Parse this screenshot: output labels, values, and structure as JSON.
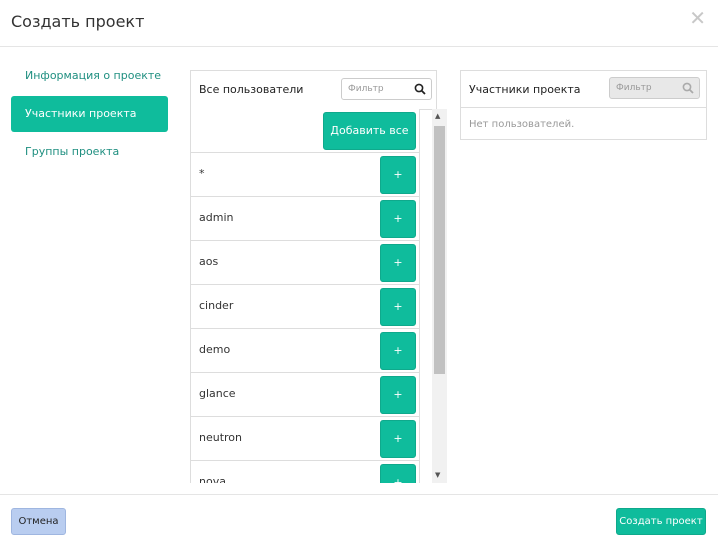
{
  "modal": {
    "title": "Создать проект",
    "close_glyph": "✕"
  },
  "nav": {
    "items": [
      {
        "label": "Информация о проекте",
        "active": false
      },
      {
        "label": "Участники проекта",
        "active": true
      },
      {
        "label": "Группы проекта",
        "active": false
      }
    ]
  },
  "all_users": {
    "title": "Все пользователи",
    "filter_placeholder": "Фильтр",
    "add_all_label": "Добавить все",
    "add_label": "+",
    "rows": [
      "*",
      "admin",
      "aos",
      "cinder",
      "demo",
      "glance",
      "neutron",
      "nova"
    ]
  },
  "members": {
    "title": "Участники проекта",
    "filter_placeholder": "Фильтр",
    "empty_text": "Нет пользователей."
  },
  "footer": {
    "cancel_label": "Отмена",
    "create_label": "Создать проект"
  },
  "colors": {
    "accent": "#0fbc9c",
    "cancel": "#b9cdf0"
  }
}
